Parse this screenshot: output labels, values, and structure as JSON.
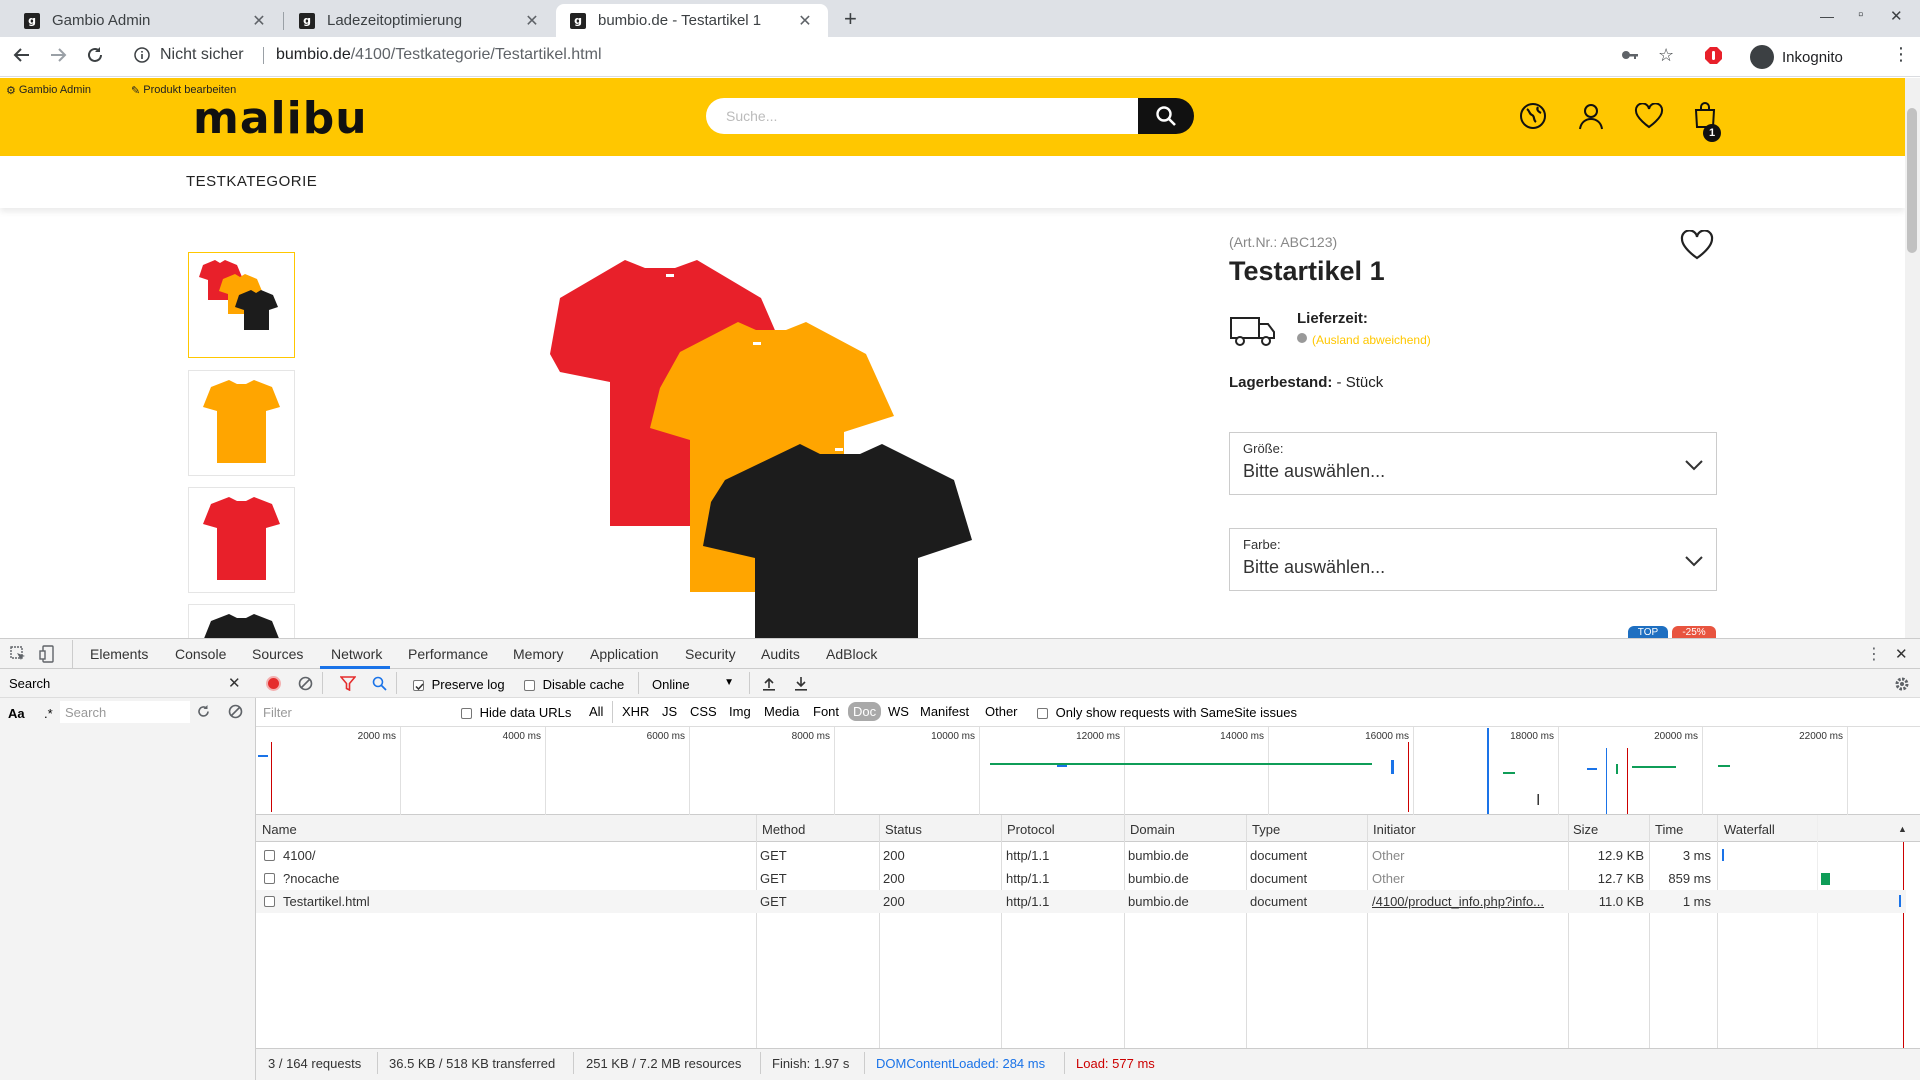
{
  "browser": {
    "tabs": [
      {
        "title": "Gambio Admin",
        "favicon": "g"
      },
      {
        "title": "Ladezeitoptimierung",
        "favicon": "g"
      },
      {
        "title": "bumbio.de - Testartikel 1",
        "favicon": "g"
      }
    ],
    "security_label": "Nicht sicher",
    "url_host": "bumbio.de",
    "url_path": "/4100/Testkategorie/Testartikel.html",
    "profile_label": "Inkognito"
  },
  "shop": {
    "admin_link": "Gambio Admin",
    "edit_link": "Produkt bearbeiten",
    "logo": "malibu",
    "search_placeholder": "Suche...",
    "cart_count": "1",
    "nav_item": "TESTKATEGORIE",
    "product": {
      "art_nr": "(Art.Nr.: ABC123)",
      "name": "Testartikel 1",
      "delivery_label": "Lieferzeit:",
      "delivery_note": "(Ausland abweichend)",
      "stock_label": "Lagerbestand:",
      "stock_value": " - Stück",
      "size_label": "Größe:",
      "size_value": "Bitte auswählen...",
      "color_label": "Farbe:",
      "color_value": "Bitte auswählen...",
      "badge_top": "TOP",
      "badge_discount": "-25%"
    },
    "colors": {
      "brand": "#ffc700",
      "red": "#e8202a",
      "orange": "#ffa500",
      "black": "#1c1c1c"
    }
  },
  "devtools": {
    "tabs": [
      "Elements",
      "Console",
      "Sources",
      "Network",
      "Performance",
      "Memory",
      "Application",
      "Security",
      "Audits",
      "AdBlock"
    ],
    "active_tab": "Network",
    "search_title": "Search",
    "search_case": "Aa",
    "search_regex": ".*",
    "search_placeholder": "Search",
    "preserve_log": "Preserve log",
    "disable_cache": "Disable cache",
    "throttling": "Online",
    "filter_placeholder": "Filter",
    "hide_data_urls": "Hide data URLs",
    "type_filters": [
      "All",
      "XHR",
      "JS",
      "CSS",
      "Img",
      "Media",
      "Font",
      "Doc",
      "WS",
      "Manifest",
      "Other"
    ],
    "active_type": "Doc",
    "samesite": "Only show requests with SameSite issues",
    "timeline_ticks": [
      "2000 ms",
      "4000 ms",
      "6000 ms",
      "8000 ms",
      "10000 ms",
      "12000 ms",
      "14000 ms",
      "16000 ms",
      "18000 ms",
      "20000 ms",
      "22000 ms"
    ],
    "columns": [
      "Name",
      "Method",
      "Status",
      "Protocol",
      "Domain",
      "Type",
      "Initiator",
      "Size",
      "Time",
      "Waterfall"
    ],
    "rows": [
      {
        "name": "4100/",
        "method": "GET",
        "status": "200",
        "protocol": "http/1.1",
        "domain": "bumbio.de",
        "type": "document",
        "initiator": "Other",
        "size": "12.9 KB",
        "time": "3 ms"
      },
      {
        "name": "?nocache",
        "method": "GET",
        "status": "200",
        "protocol": "http/1.1",
        "domain": "bumbio.de",
        "type": "document",
        "initiator": "Other",
        "size": "12.7 KB",
        "time": "859 ms"
      },
      {
        "name": "Testartikel.html",
        "method": "GET",
        "status": "200",
        "protocol": "http/1.1",
        "domain": "bumbio.de",
        "type": "document",
        "initiator": "/4100/product_info.php?info...",
        "size": "11.0 KB",
        "time": "1 ms"
      }
    ],
    "status": {
      "requests": "3 / 164 requests",
      "transferred": "36.5 KB / 518 KB transferred",
      "resources": "251 KB / 7.2 MB resources",
      "finish": "Finish: 1.97 s",
      "dcl": "DOMContentLoaded: 284 ms",
      "load": "Load: 577 ms"
    }
  }
}
